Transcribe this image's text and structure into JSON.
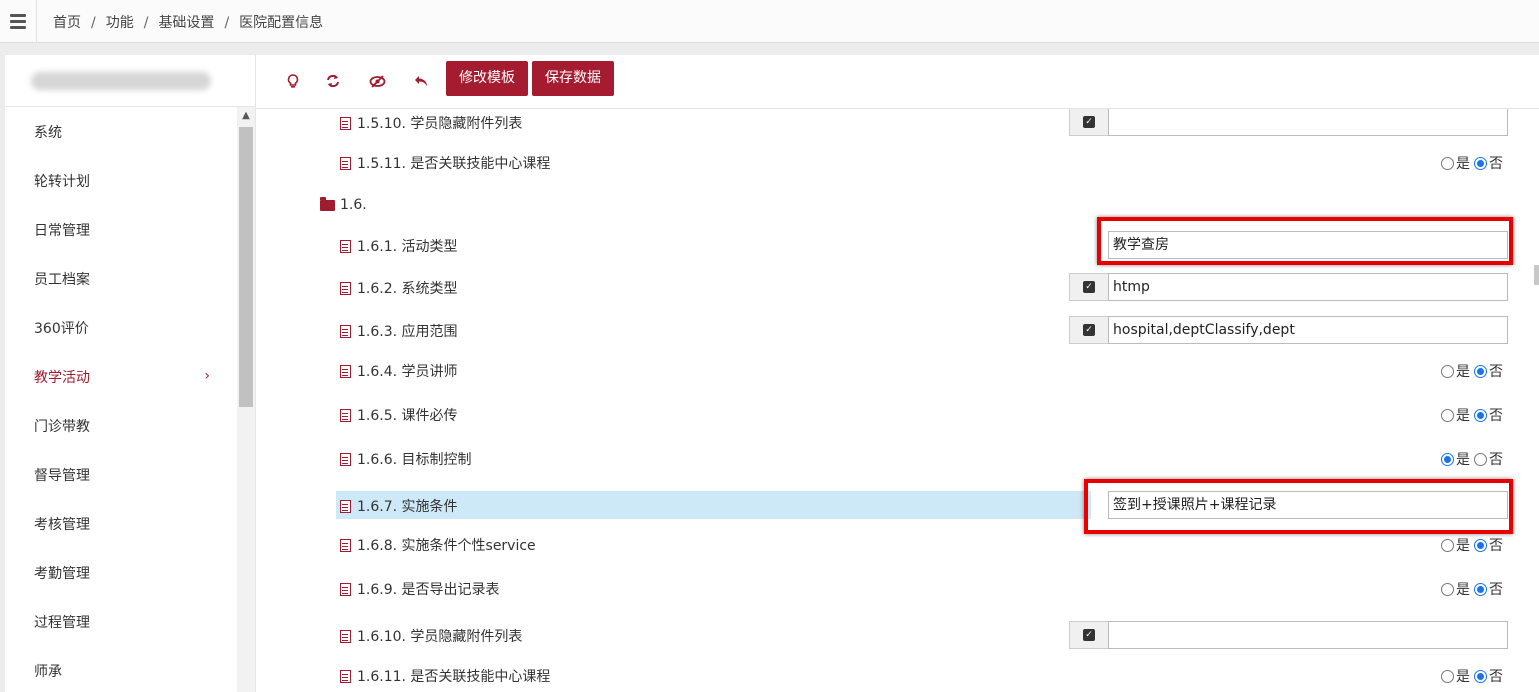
{
  "breadcrumb": [
    "首页",
    "功能",
    "基础设置",
    "医院配置信息"
  ],
  "sidebar": {
    "items": [
      {
        "label": "系统"
      },
      {
        "label": "轮转计划"
      },
      {
        "label": "日常管理"
      },
      {
        "label": "员工档案"
      },
      {
        "label": "360评价"
      },
      {
        "label": "教学活动",
        "active": true
      },
      {
        "label": "门诊带教"
      },
      {
        "label": "督导管理"
      },
      {
        "label": "考核管理"
      },
      {
        "label": "考勤管理"
      },
      {
        "label": "过程管理"
      },
      {
        "label": "师承"
      }
    ]
  },
  "toolbar": {
    "icons": [
      "lightbulb-icon",
      "refresh-icon",
      "eye-slash-icon",
      "undo-icon"
    ],
    "edit_template_label": "修改模板",
    "save_data_label": "保存数据"
  },
  "config": {
    "r1_5_10": {
      "label": "1.5.10. 学员隐藏附件列表",
      "value": ""
    },
    "r1_5_11": {
      "label": "1.5.11. 是否关联技能中心课程",
      "selected": "否"
    },
    "folder_1_6": {
      "label": "1.6."
    },
    "r1_6_1": {
      "label": "1.6.1. 活动类型",
      "value": "教学查房"
    },
    "r1_6_2": {
      "label": "1.6.2. 系统类型",
      "value": "htmp"
    },
    "r1_6_3": {
      "label": "1.6.3. 应用范围",
      "value": "hospital,deptClassify,dept"
    },
    "r1_6_4": {
      "label": "1.6.4. 学员讲师",
      "selected": "否"
    },
    "r1_6_5": {
      "label": "1.6.5. 课件必传",
      "selected": "否"
    },
    "r1_6_6": {
      "label": "1.6.6. 目标制控制",
      "selected": "是"
    },
    "r1_6_7": {
      "label": "1.6.7. 实施条件",
      "value": "签到+授课照片+课程记录"
    },
    "r1_6_8": {
      "label": "1.6.8. 实施条件个性service",
      "selected": "否"
    },
    "r1_6_9": {
      "label": "1.6.9. 是否导出记录表",
      "selected": "否"
    },
    "r1_6_10": {
      "label": "1.6.10. 学员隐藏附件列表",
      "value": ""
    },
    "r1_6_11": {
      "label": "1.6.11. 是否关联技能中心课程",
      "selected": "否"
    }
  },
  "radio_options": {
    "yes": "是",
    "no": "否"
  },
  "colors": {
    "brand": "#a51c30",
    "highlight_row": "#cde8f7",
    "annotation_box": "#e80000",
    "radio_selected": "#1a73e8"
  }
}
